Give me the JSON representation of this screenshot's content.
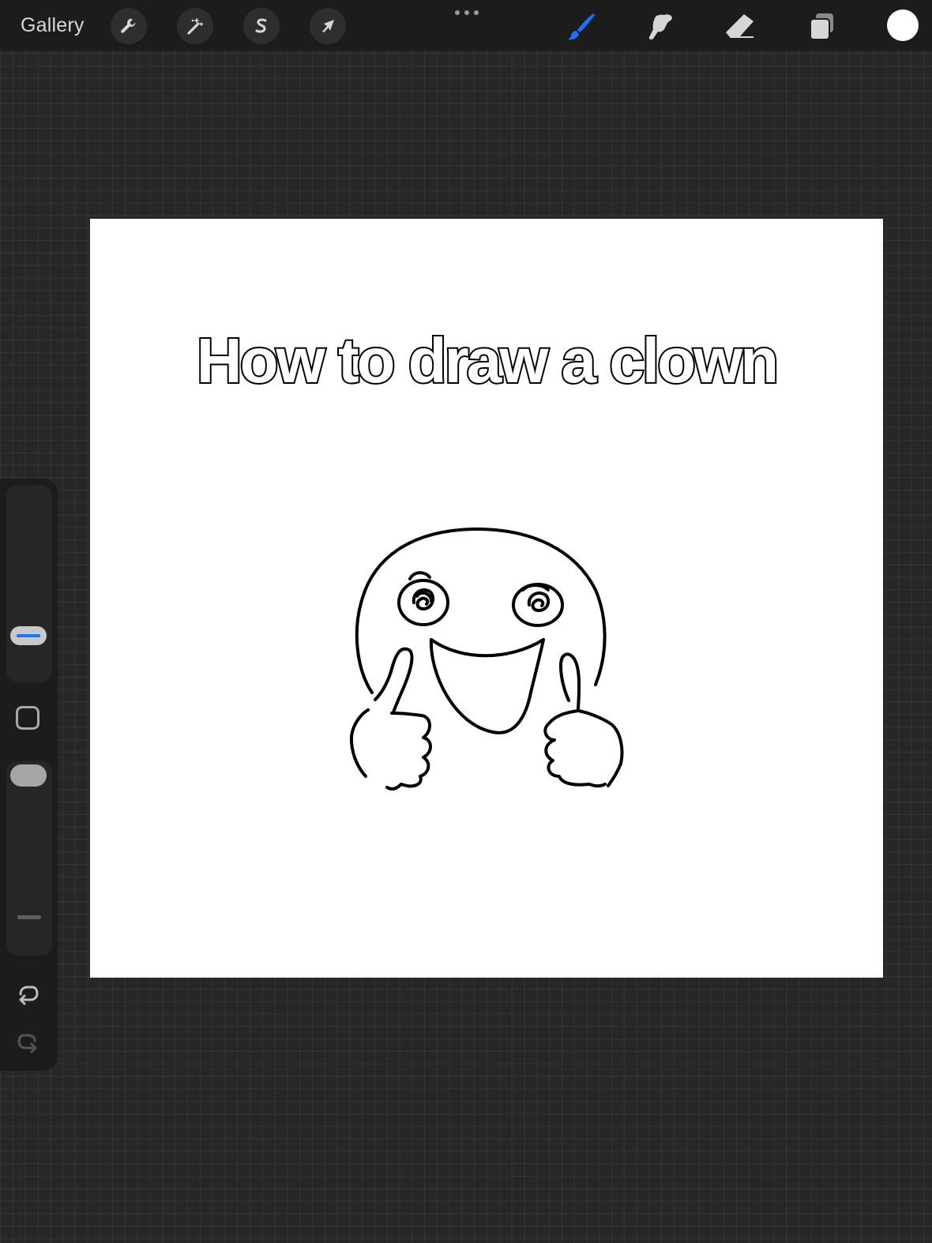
{
  "toolbar": {
    "gallery_label": "Gallery",
    "left_tools": [
      {
        "name": "actions",
        "icon": "wrench-icon"
      },
      {
        "name": "adjustments",
        "icon": "magic-wand-icon"
      },
      {
        "name": "selection",
        "icon": "selection-s-icon"
      },
      {
        "name": "transform",
        "icon": "arrow-cursor-icon"
      }
    ],
    "right_tools": [
      {
        "name": "brush",
        "icon": "brush-icon",
        "active": true
      },
      {
        "name": "smudge",
        "icon": "smudge-icon",
        "active": false
      },
      {
        "name": "eraser",
        "icon": "eraser-icon",
        "active": false
      },
      {
        "name": "layers",
        "icon": "layers-icon",
        "active": false
      }
    ],
    "current_color": "#ffffff",
    "accent_color": "#1a73ff"
  },
  "canvas": {
    "title_text": "How to draw a clown",
    "background": "#ffffff"
  },
  "sidebar": {
    "brush_size_level": 0.25,
    "opacity_level": 0.95
  }
}
